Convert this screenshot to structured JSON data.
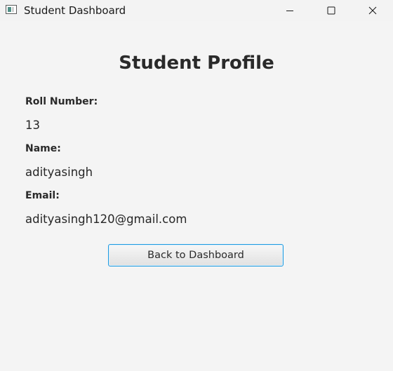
{
  "window": {
    "title": "Student Dashboard",
    "controls": {
      "minimize_icon": "minimize-icon",
      "maximize_icon": "maximize-icon",
      "close_icon": "close-icon"
    }
  },
  "profile": {
    "heading": "Student Profile",
    "fields": [
      {
        "label": "Roll Number:",
        "value": "13"
      },
      {
        "label": "Name:",
        "value": "adityasingh"
      },
      {
        "label": "Email:",
        "value": "adityasingh120@gmail.com"
      }
    ]
  },
  "actions": {
    "back_label": "Back to Dashboard"
  },
  "colors": {
    "background": "#f4f4f4",
    "focus_border": "#1f9be0",
    "text": "#262626"
  }
}
